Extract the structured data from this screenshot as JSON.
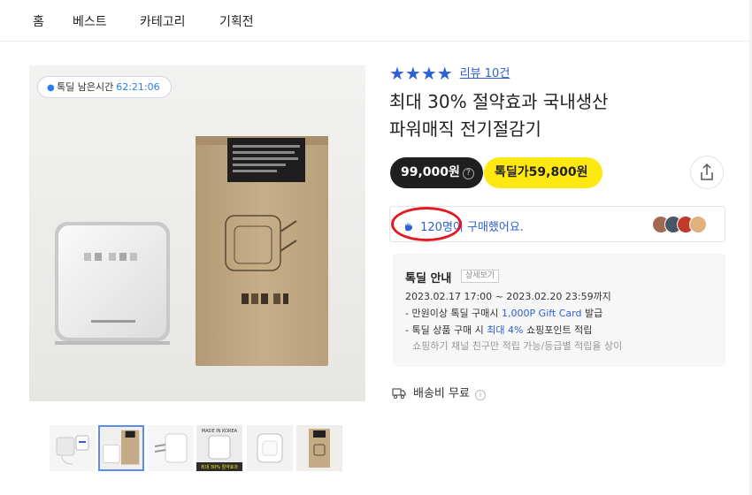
{
  "nav": {
    "items": [
      "홈",
      "베스트",
      "카테고리",
      "기획전"
    ]
  },
  "gallery": {
    "timer_label": "톡딜 남은시간",
    "timer_value": "62:21:06",
    "box_text": "KOREA",
    "device_text": "MADE IN KOREA",
    "thumb_caption_top": "MADE IN KOREA",
    "thumb_caption_bottom": "최대 30% 절약효과",
    "thumbs": [
      "thumb-1",
      "thumb-2",
      "thumb-3",
      "thumb-4",
      "thumb-5",
      "thumb-6"
    ],
    "active_thumb": 1
  },
  "product": {
    "stars": "★★★★",
    "review_link": "리뷰 10건",
    "title_line1": "최대 30% 절약효과 국내생산",
    "title_line2": "파워매직 전기절감기",
    "price_regular": "99,000원",
    "price_question": "?",
    "price_deal": "톡딜가59,800원",
    "share_icon": "share-icon"
  },
  "buyers": {
    "count": "120명이",
    "rest": " 구매했어요.",
    "hand_icon": "hand-wave-icon",
    "avatar_colors": [
      "#a36a52",
      "#4a5568",
      "#c0392b",
      "#e2b07a"
    ]
  },
  "deal_info": {
    "title": "톡딜 안내",
    "detail_button": "상세보기",
    "period": "2023.02.17 17:00 ~ 2023.02.20 23:59까지",
    "line1_prefix": "- 만원이상 톡딜 구매시 ",
    "line1_highlight": "1,000P Gift Card",
    "line1_suffix": " 발급",
    "line2_prefix": "- 톡딜 상품 구매 시 ",
    "line2_highlight": "최대 4%",
    "line2_suffix": " 쇼핑포인트 적립",
    "note": "쇼핑하기 채널 친구만 적립 가능/등급별 적립율 상이"
  },
  "shipping": {
    "label": "배송비 무료",
    "info": "i"
  },
  "colors": {
    "accent_blue": "#2d5fd6",
    "deal_yellow": "#fde811",
    "dark_pill": "#1f1f1f",
    "highlight_red": "#e21b23"
  }
}
